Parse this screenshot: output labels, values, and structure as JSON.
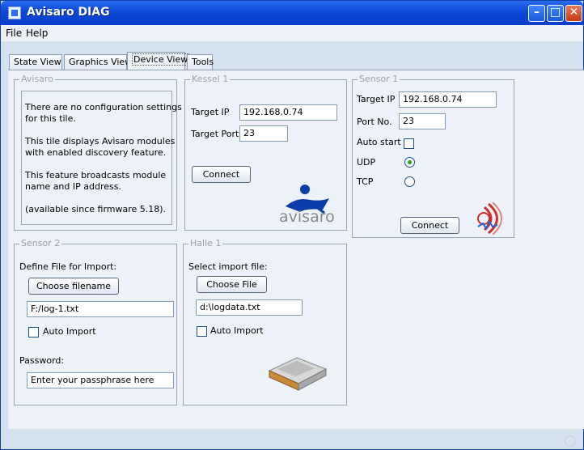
{
  "window": {
    "title": "Avisaro DIAG"
  },
  "menubar": {
    "items": [
      "File",
      "Help"
    ]
  },
  "tabs": [
    "State View",
    "Graphics View",
    "Device View",
    "Tools"
  ],
  "active_tab": "Device View",
  "panels": {
    "avisaro": {
      "title": "Avisaro",
      "lines": [
        "There are no configuration settings",
        "for this tile.",
        "This tile displays Avisaro modules",
        "with enabled discovery feature.",
        "This feature broadcasts module",
        "name and IP address.",
        "(available since firmware 5.18)."
      ]
    },
    "kessel": {
      "title": "Kessel 1",
      "target_ip_label": "Target IP",
      "target_ip": "192.168.0.74",
      "target_port_label": "Target Port",
      "target_port": "23",
      "connect_label": "Connect",
      "logo_text": "avisaro"
    },
    "sensor1": {
      "title": "Sensor 1",
      "target_ip_label": "Target IP",
      "target_ip": "192.168.0.74",
      "port_label": "Port No.",
      "port": "23",
      "auto_start_label": "Auto start",
      "auto_start": false,
      "udp_label": "UDP",
      "tcp_label": "TCP",
      "protocol": "UDP",
      "connect_label": "Connect"
    },
    "sensor2": {
      "title": "Sensor 2",
      "define_label": "Define File for Import:",
      "choose_label": "Choose filename",
      "file_value": "F:/log-1.txt",
      "auto_import_label": "Auto Import",
      "auto_import": false,
      "password_label": "Password:",
      "password_value": "Enter your passphrase here"
    },
    "halle": {
      "title": "Halle 1",
      "select_label": "Select import file:",
      "choose_label": "Choose File",
      "file_value": "d:\\logdata.txt",
      "auto_import_label": "Auto Import",
      "auto_import": false
    }
  },
  "colors": {
    "title_bar": "#0c47d6",
    "panel_bg": "#edf2f9",
    "window_bg": "#d4e1ef",
    "radio_selected": "#21a121"
  },
  "icons": [
    "app-icon",
    "minimize-icon",
    "maximize-icon",
    "close-icon",
    "avisaro-logo",
    "sensor-signal-icon",
    "storage-device-icon",
    "status-circle-icon"
  ]
}
